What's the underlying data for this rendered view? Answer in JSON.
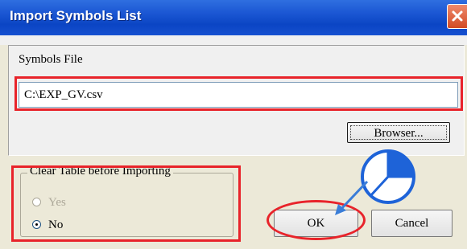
{
  "dialog": {
    "title": "Import Symbols List",
    "close_icon": "close-icon"
  },
  "symbols_file": {
    "label": "Symbols File",
    "value": "C:\\EXP_GV.csv"
  },
  "browser_button": {
    "label": "Browser..."
  },
  "clear_table": {
    "legend": "Clear Table before Importing",
    "options": [
      {
        "label": "Yes",
        "selected": false,
        "enabled": false
      },
      {
        "label": "No",
        "selected": true,
        "enabled": true
      }
    ]
  },
  "buttons": {
    "ok": "OK",
    "cancel": "Cancel"
  },
  "annotations": {
    "highlight_color": "#e8232a",
    "pointer_color": "#3a7dd8",
    "icons": [
      "pie-chart-icon",
      "arrow-icon"
    ]
  }
}
